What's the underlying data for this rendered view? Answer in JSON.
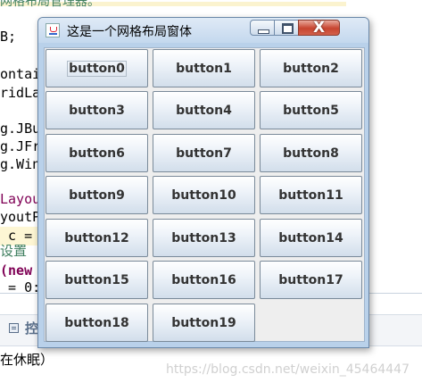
{
  "ide": {
    "top_comment": "网格布局管理器。",
    "code_lines": [
      "B;",
      "",
      "ontai",
      "ridLa",
      "",
      "g.JBu",
      "g.JFr",
      "g.Win",
      "",
      "Layou",
      "youtP",
      " c = ",
      "设置",
      "(new ",
      " = 0:"
    ],
    "console_tab": "控",
    "console_text": "在休眠）",
    "watermark": "https://blog.csdn.net/weixin_45464447"
  },
  "window": {
    "title": "这是一个网格布局窗体",
    "close_glyph": "X",
    "buttons": [
      "button0",
      "button1",
      "button2",
      "button3",
      "button4",
      "button5",
      "button6",
      "button7",
      "button8",
      "button9",
      "button10",
      "button11",
      "button12",
      "button13",
      "button14",
      "button15",
      "button16",
      "button17",
      "button18",
      "button19"
    ]
  },
  "icons": {
    "app": "java-coffee-icon",
    "minimize": "minimize-icon",
    "maximize": "maximize-icon",
    "close": "close-icon",
    "console": "console-icon"
  },
  "colors": {
    "titlebar": "#c4d8ee",
    "close_button": "#c7442f",
    "button_face": "#d2deeb",
    "content_bg": "#eeeeee"
  }
}
